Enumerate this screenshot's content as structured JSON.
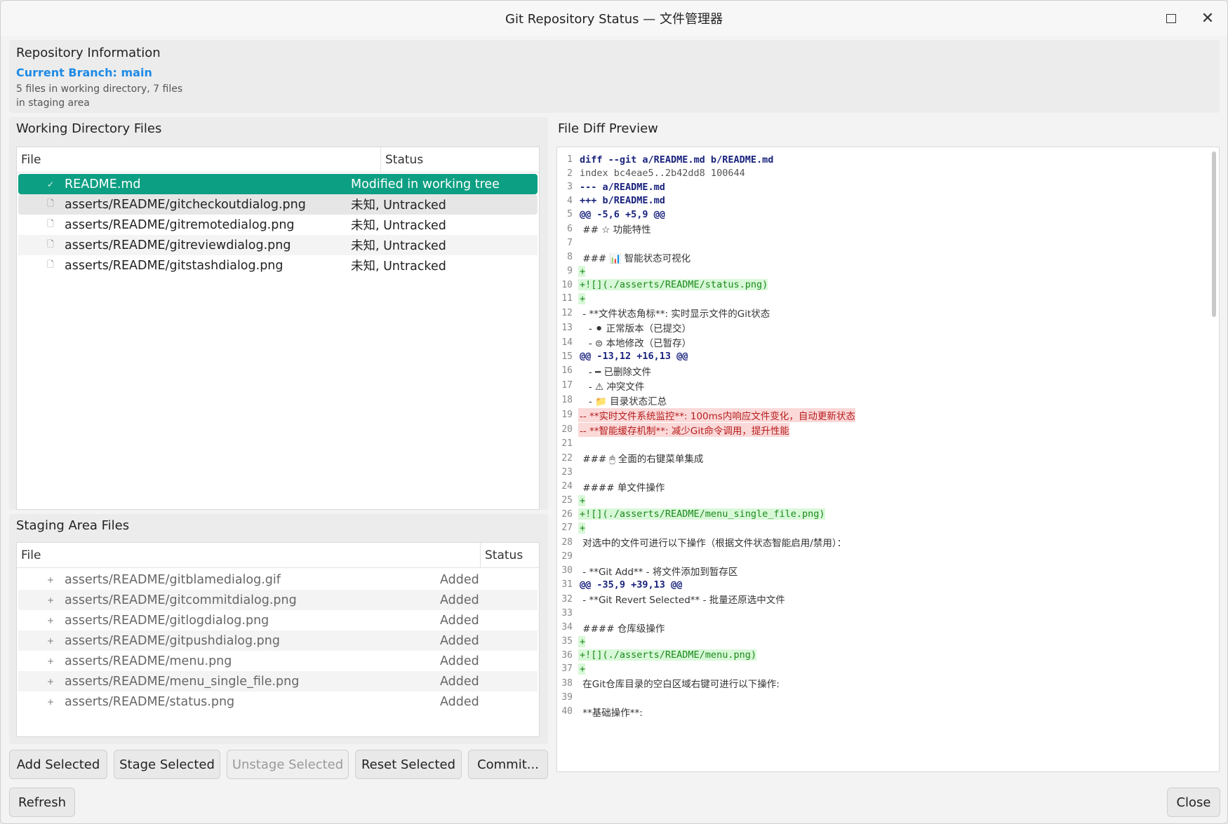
{
  "window": {
    "title": "Git Repository Status — 文件管理器"
  },
  "repo": {
    "heading": "Repository Information",
    "branch": "Current Branch: main",
    "summary": "5 files in working directory, 7 files in staging area"
  },
  "working": {
    "title": "Working Directory Files",
    "col_file": "File",
    "col_status": "Status",
    "rows": [
      {
        "icon": "✓",
        "file": "README.md",
        "status": "Modified in working tree"
      },
      {
        "icon": "🗋",
        "file": "asserts/README/gitcheckoutdialog.png",
        "status": "未知, Untracked"
      },
      {
        "icon": "🗋",
        "file": "asserts/README/gitremotedialog.png",
        "status": "未知, Untracked"
      },
      {
        "icon": "🗋",
        "file": "asserts/README/gitreviewdialog.png",
        "status": "未知, Untracked"
      },
      {
        "icon": "🗋",
        "file": "asserts/README/gitstashdialog.png",
        "status": "未知, Untracked"
      }
    ]
  },
  "staging": {
    "title": "Staging Area Files",
    "col_file": "File",
    "col_status": "Status",
    "rows": [
      {
        "icon": "+",
        "file": "asserts/README/gitblamedialog.gif",
        "status": "Added"
      },
      {
        "icon": "+",
        "file": "asserts/README/gitcommitdialog.png",
        "status": "Added"
      },
      {
        "icon": "+",
        "file": "asserts/README/gitlogdialog.png",
        "status": "Added"
      },
      {
        "icon": "+",
        "file": "asserts/README/gitpushdialog.png",
        "status": "Added"
      },
      {
        "icon": "+",
        "file": "asserts/README/menu.png",
        "status": "Added"
      },
      {
        "icon": "+",
        "file": "asserts/README/menu_single_file.png",
        "status": "Added"
      },
      {
        "icon": "+",
        "file": "asserts/README/status.png",
        "status": "Added"
      }
    ]
  },
  "diff": {
    "title": "File Diff Preview",
    "lines": [
      {
        "n": "1",
        "type": "header",
        "text": "diff --git a/README.md b/README.md"
      },
      {
        "n": "2",
        "type": "index",
        "text": "index bc4eae5..2b42dd8 100644"
      },
      {
        "n": "3",
        "type": "header",
        "text": "--- a/README.md"
      },
      {
        "n": "4",
        "type": "header",
        "text": "+++ b/README.md"
      },
      {
        "n": "5",
        "type": "hunk",
        "text": "@@ -5,6 +5,9 @@"
      },
      {
        "n": "6",
        "type": "ctx",
        "text": " ## ☆ 功能特性"
      },
      {
        "n": "7",
        "type": "ctx",
        "text": " "
      },
      {
        "n": "8",
        "type": "ctx",
        "text": " ### 📊 智能状态可视化"
      },
      {
        "n": "9",
        "type": "add",
        "text": "+"
      },
      {
        "n": "10",
        "type": "add",
        "text": "+![](./asserts/README/status.png)"
      },
      {
        "n": "11",
        "type": "add",
        "text": "+"
      },
      {
        "n": "12",
        "type": "ctx",
        "text": " - **文件状态角标**: 实时显示文件的Git状态"
      },
      {
        "n": "13",
        "type": "ctx",
        "text": "   - ⚫ 正常版本（已提交）"
      },
      {
        "n": "14",
        "type": "ctx",
        "text": "   - ⊜ 本地修改（已暂存）"
      },
      {
        "n": "15",
        "type": "hunk",
        "text": "@@ -13,12 +16,13 @@"
      },
      {
        "n": "16",
        "type": "ctx",
        "text": "   - ━ 已删除文件"
      },
      {
        "n": "17",
        "type": "ctx",
        "text": "   - ⚠ 冲突文件"
      },
      {
        "n": "18",
        "type": "ctx",
        "text": "   - 📁 目录状态汇总"
      },
      {
        "n": "19",
        "type": "del",
        "text": "-- **实时文件系统监控**: 100ms内响应文件变化，自动更新状态"
      },
      {
        "n": "20",
        "type": "del",
        "text": "-- **智能缓存机制**: 减少Git命令调用，提升性能"
      },
      {
        "n": "21",
        "type": "ctx",
        "text": " "
      },
      {
        "n": "22",
        "type": "ctx",
        "text": " ### 🖱 全面的右键菜单集成"
      },
      {
        "n": "23",
        "type": "ctx",
        "text": " "
      },
      {
        "n": "24",
        "type": "ctx",
        "text": " #### 单文件操作"
      },
      {
        "n": "25",
        "type": "add",
        "text": "+"
      },
      {
        "n": "26",
        "type": "add",
        "text": "+![](./asserts/README/menu_single_file.png)"
      },
      {
        "n": "27",
        "type": "add",
        "text": "+"
      },
      {
        "n": "28",
        "type": "ctx",
        "text": " 对选中的文件可进行以下操作（根据文件状态智能启用/禁用）："
      },
      {
        "n": "29",
        "type": "ctx",
        "text": " "
      },
      {
        "n": "30",
        "type": "ctx",
        "text": " - **Git Add** - 将文件添加到暂存区"
      },
      {
        "n": "31",
        "type": "hunk",
        "text": "@@ -35,9 +39,13 @@"
      },
      {
        "n": "32",
        "type": "ctx",
        "text": " - **Git Revert Selected** - 批量还原选中文件"
      },
      {
        "n": "33",
        "type": "ctx",
        "text": " "
      },
      {
        "n": "34",
        "type": "ctx",
        "text": " #### 仓库级操作"
      },
      {
        "n": "35",
        "type": "add",
        "text": "+"
      },
      {
        "n": "36",
        "type": "add",
        "text": "+![](./asserts/README/menu.png)"
      },
      {
        "n": "37",
        "type": "add",
        "text": "+"
      },
      {
        "n": "38",
        "type": "ctx",
        "text": " 在Git仓库目录的空白区域右键可进行以下操作:"
      },
      {
        "n": "39",
        "type": "ctx",
        "text": " "
      },
      {
        "n": "40",
        "type": "ctx",
        "text": " **基础操作**:"
      }
    ]
  },
  "buttons": {
    "add": "Add Selected",
    "stage": "Stage Selected",
    "unstage": "Unstage Selected",
    "reset": "Reset Selected",
    "commit": "Commit...",
    "refresh": "Refresh",
    "close": "Close"
  },
  "colors": {
    "selection": "#0d9f83",
    "branch": "#1e8ae6",
    "add_bg": "#d8f8d8",
    "del_bg": "#fbd9d9"
  }
}
